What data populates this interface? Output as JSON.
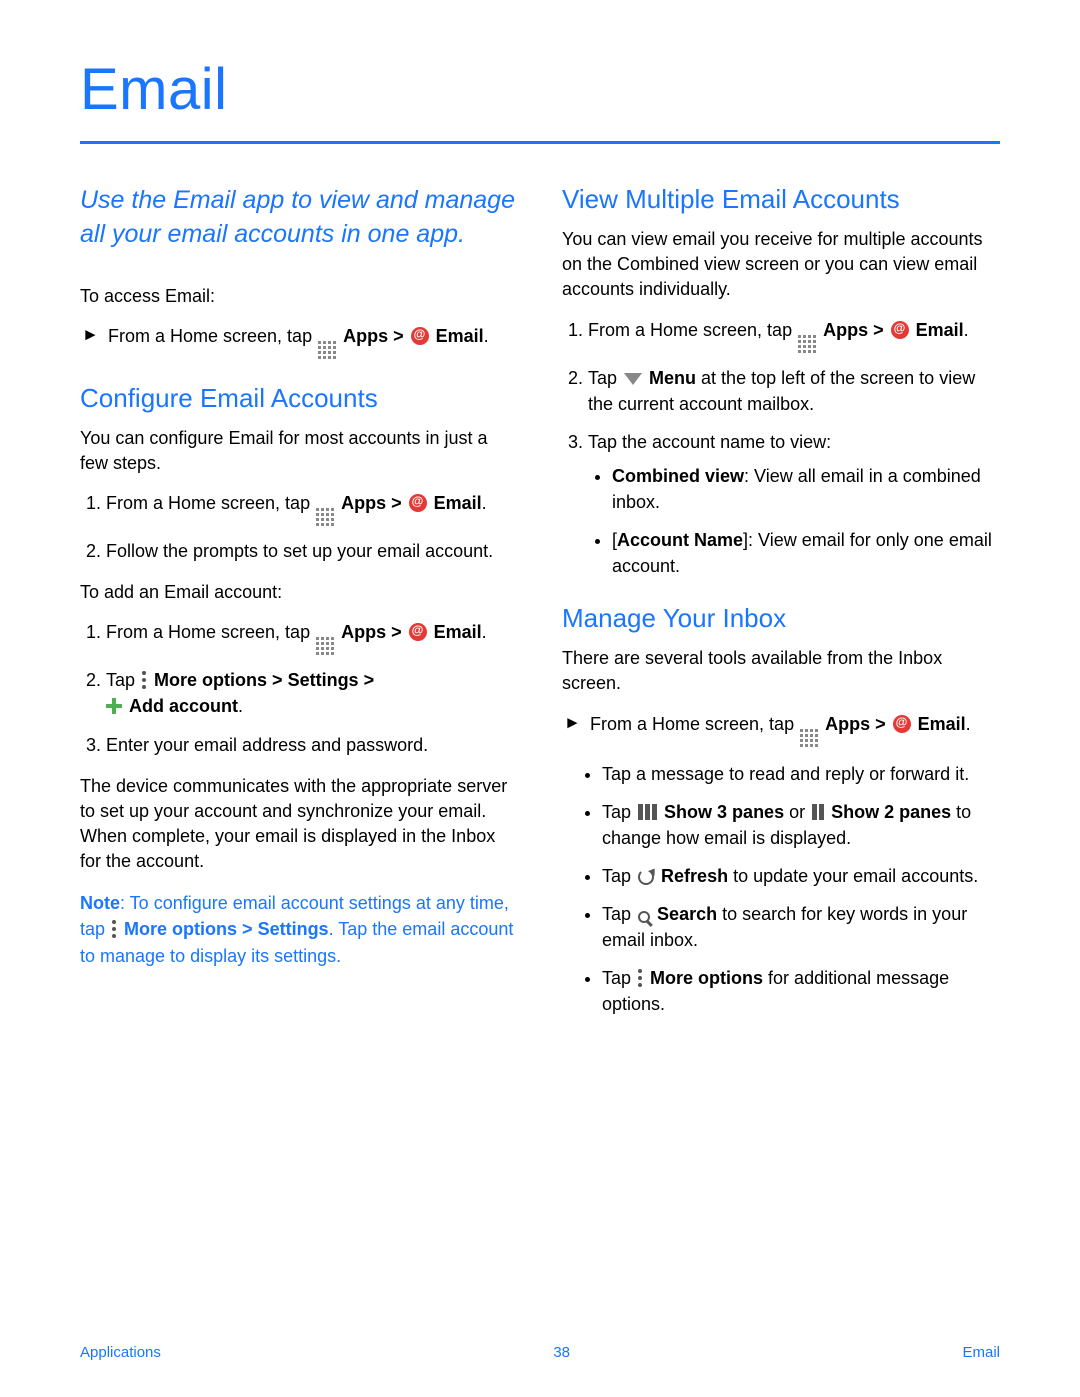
{
  "title": "Email",
  "intro": "Use the Email app to view and manage all your email accounts in one app.",
  "access_label": "To access Email:",
  "home_prefix": "From a Home screen, tap ",
  "apps_label": "Apps",
  "sep": " > ",
  "email_label": "Email",
  "period": ".",
  "configure": {
    "heading": "Configure Email Accounts",
    "lead": "You can configure Email for most accounts in just a few steps.",
    "step2": "Follow the prompts to set up your email account.",
    "add_label": "To add an Email account:",
    "tap_prefix": "Tap ",
    "more_options": "More options",
    "settings": "Settings",
    "add_account": "Add account",
    "step3": "Enter your email address and password.",
    "para": "The device communicates with the appropriate server to set up your account and synchronize your email. When complete, your email is displayed in the Inbox for the account.",
    "note_label": "Note",
    "note_a": ": To configure email account settings at any time, tap ",
    "note_b": ". Tap the email account to manage to display its settings."
  },
  "multi": {
    "heading": "View Multiple Email Accounts",
    "lead": "You can view email you receive for multiple accounts on the Combined view screen or you can view email accounts individually.",
    "tap_prefix": "Tap ",
    "menu_label": "Menu",
    "menu_tail": " at the top left of the screen to view the current account mailbox.",
    "step3": "Tap the account name to view:",
    "combined_label": "Combined view",
    "combined_tail": ": View all email in a combined inbox.",
    "acct_label": "Account Name",
    "acct_tail": "]: View email for only one email account."
  },
  "inbox": {
    "heading": "Manage Your Inbox",
    "lead": "There are several tools available from the Inbox screen.",
    "b1": "Tap a message to read and reply or forward it.",
    "tap_prefix": "Tap ",
    "show3": "Show 3 panes",
    "or": " or ",
    "show2": "Show 2 panes",
    "panes_tail": " to change how email is displayed.",
    "refresh": "Refresh",
    "refresh_tail": " to update your email accounts.",
    "search": "Search",
    "search_tail": " to search for key words in your email inbox.",
    "more_options": "More options",
    "more_tail": " for additional message options."
  },
  "footer": {
    "left": "Applications",
    "center": "38",
    "right": "Email"
  }
}
